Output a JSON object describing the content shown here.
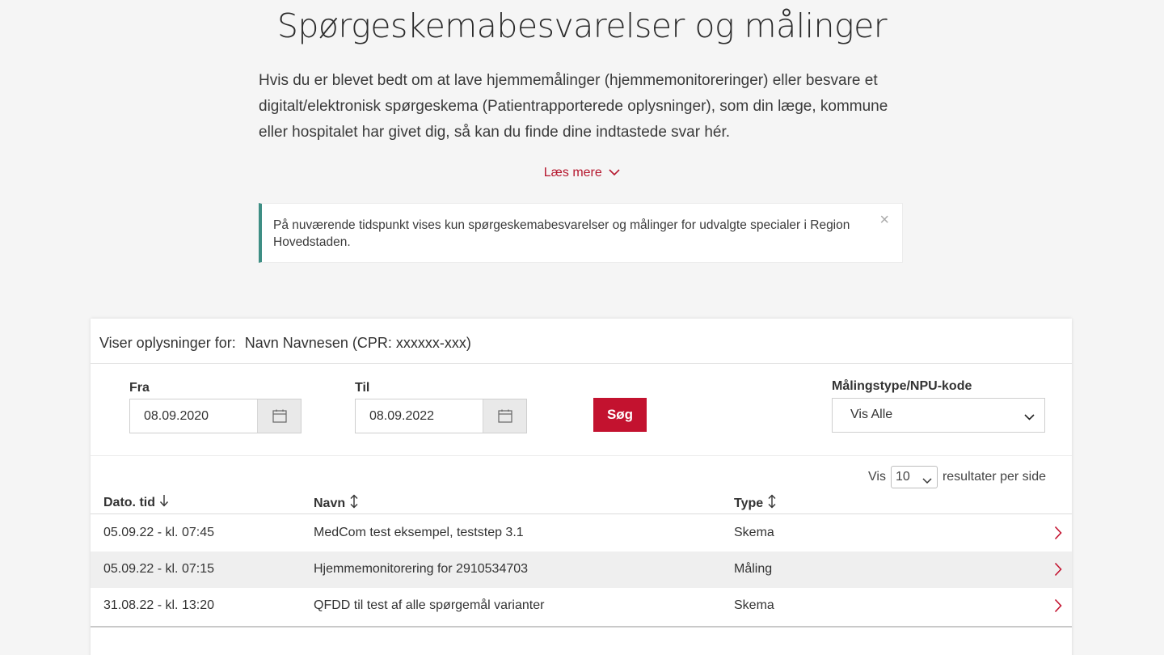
{
  "page": {
    "title": "Spørgeskemabesvarelser og målinger",
    "intro": "Hvis du er blevet bedt om at lave hjemmemålinger (hjemmemonitoreringer) eller besvare et digitalt/elektronisk spørgeskema (Patientrapporterede oplysninger), som din læge, kommune eller hospitalet har givet dig, så kan du finde dine indtastede svar hér.",
    "read_more": "Læs mere"
  },
  "notice": {
    "text": "På nuværende tidspunkt vises kun spørgeskemabesvarelser og målinger for udvalgte specialer i Region Hovedstaden.",
    "close": "×"
  },
  "card": {
    "viewing_label": "Viser oplysninger for:",
    "patient": "Navn Navnesen (CPR: xxxxxx-xxx)"
  },
  "filter": {
    "from_label": "Fra",
    "from_value": "08.09.2020",
    "to_label": "Til",
    "to_value": "08.09.2022",
    "search_label": "Søg",
    "type_label": "Målingstype/NPU-kode",
    "type_value": "Vis Alle"
  },
  "pagination": {
    "prefix": "Vis",
    "value": "10",
    "suffix": "resultater per side"
  },
  "table": {
    "headers": {
      "date": "Dato. tid",
      "name": "Navn",
      "type": "Type"
    },
    "rows": [
      {
        "date": "05.09.22 - kl. 07:45",
        "name": "MedCom test eksempel, teststep 3.1",
        "type": "Skema"
      },
      {
        "date": "05.09.22 - kl. 07:15",
        "name": "Hjemmemonitorering for 2910534703",
        "type": "Måling"
      },
      {
        "date": "31.08.22 - kl. 13:20",
        "name": "QFDD til test af alle spørgemål varianter",
        "type": "Skema"
      }
    ]
  },
  "colors": {
    "accent_red": "#c3122f",
    "link_red": "#b5172e",
    "notice_border": "#3e8e84"
  },
  "icons": [
    "chevron-down-icon",
    "close-icon",
    "calendar-icon",
    "sort-down-icon",
    "sort-both-icon",
    "chevron-right-icon"
  ]
}
